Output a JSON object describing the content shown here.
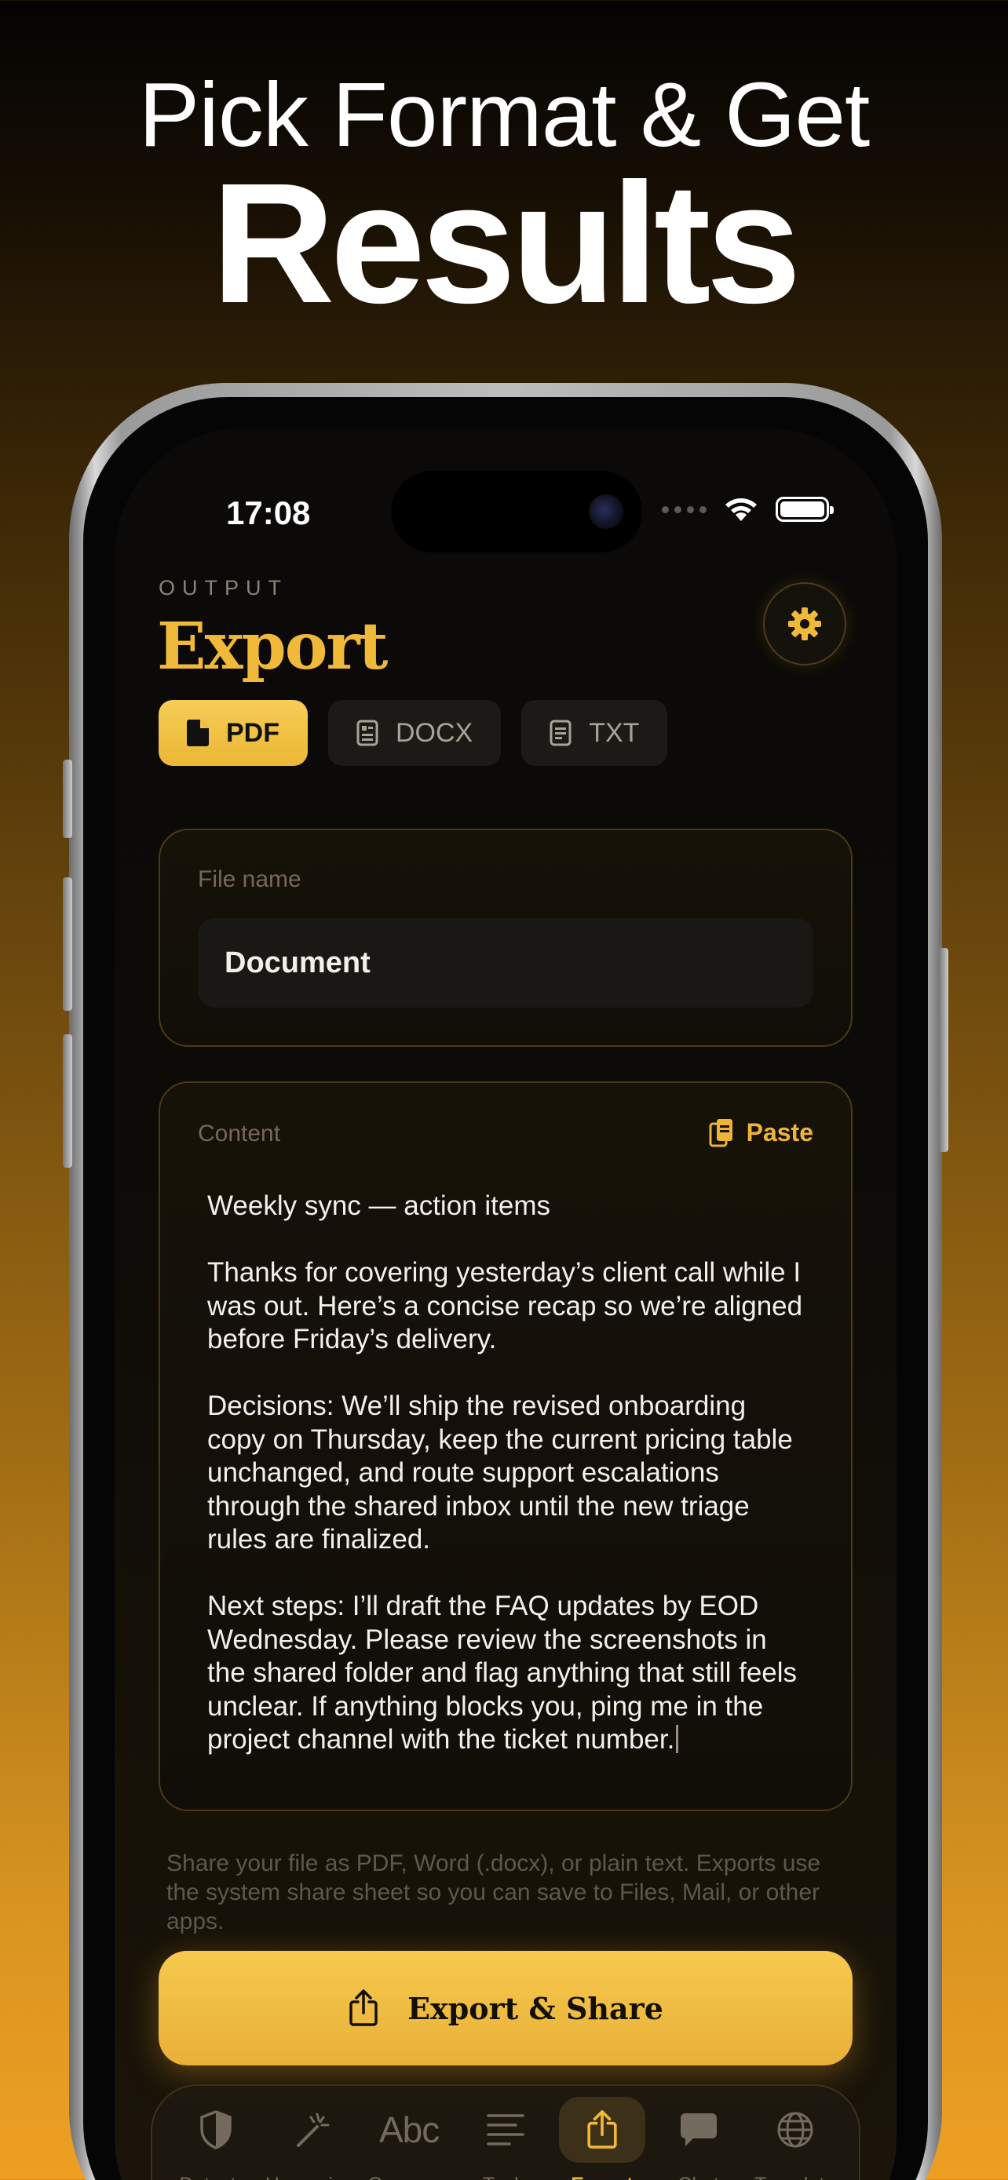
{
  "headline": {
    "line1": "Pick Format & Get",
    "line2": "Results"
  },
  "status_bar": {
    "time": "17:08"
  },
  "header": {
    "eyebrow": "OUTPUT",
    "title": "Export"
  },
  "formats": [
    {
      "label": "PDF",
      "icon": "document-filled-icon",
      "selected": true
    },
    {
      "label": "DOCX",
      "icon": "docx-file-icon",
      "selected": false
    },
    {
      "label": "TXT",
      "icon": "text-file-icon",
      "selected": false
    }
  ],
  "file_card": {
    "label": "File name",
    "value": "Document"
  },
  "content_card": {
    "label": "Content",
    "paste_label": "Paste",
    "text": "Weekly sync — action items\n\nThanks for covering yesterday’s client call while I was out. Here’s a concise recap so we’re aligned before Friday’s delivery.\n\nDecisions: We’ll ship the revised onboarding copy on Thursday, keep the current pricing table unchanged, and route support escalations through the shared inbox until the new triage rules are finalized.\n\nNext steps: I’ll draft the FAQ updates by EOD Wednesday. Please review the screenshots in the shared folder and flag anything that still feels unclear. If anything blocks you, ping me in the project channel with the ticket number."
  },
  "note": "Share your file as PDF, Word (.docx), or plain text. Exports use the system share sheet so you can save to Files, Mail, or other apps.",
  "cta": {
    "label": "Export & Share",
    "icon": "share-icon"
  },
  "tabbar": [
    {
      "label": "Detector",
      "icon": "shield-icon",
      "active": false
    },
    {
      "label": "Humanizer",
      "icon": "magic-wand-icon",
      "active": false
    },
    {
      "label": "Grammar",
      "icon": "abc-icon",
      "glyph": "Abc",
      "active": false
    },
    {
      "label": "Tools",
      "icon": "lines-icon",
      "active": false
    },
    {
      "label": "Export",
      "icon": "share-icon",
      "active": true
    },
    {
      "label": "Chat",
      "icon": "chat-bubble-icon",
      "active": false
    },
    {
      "label": "Translate",
      "icon": "globe-icon",
      "active": false
    }
  ],
  "colors": {
    "accent": "#F1B93A",
    "background": "#0B0A08",
    "muted": "#736B5D"
  }
}
